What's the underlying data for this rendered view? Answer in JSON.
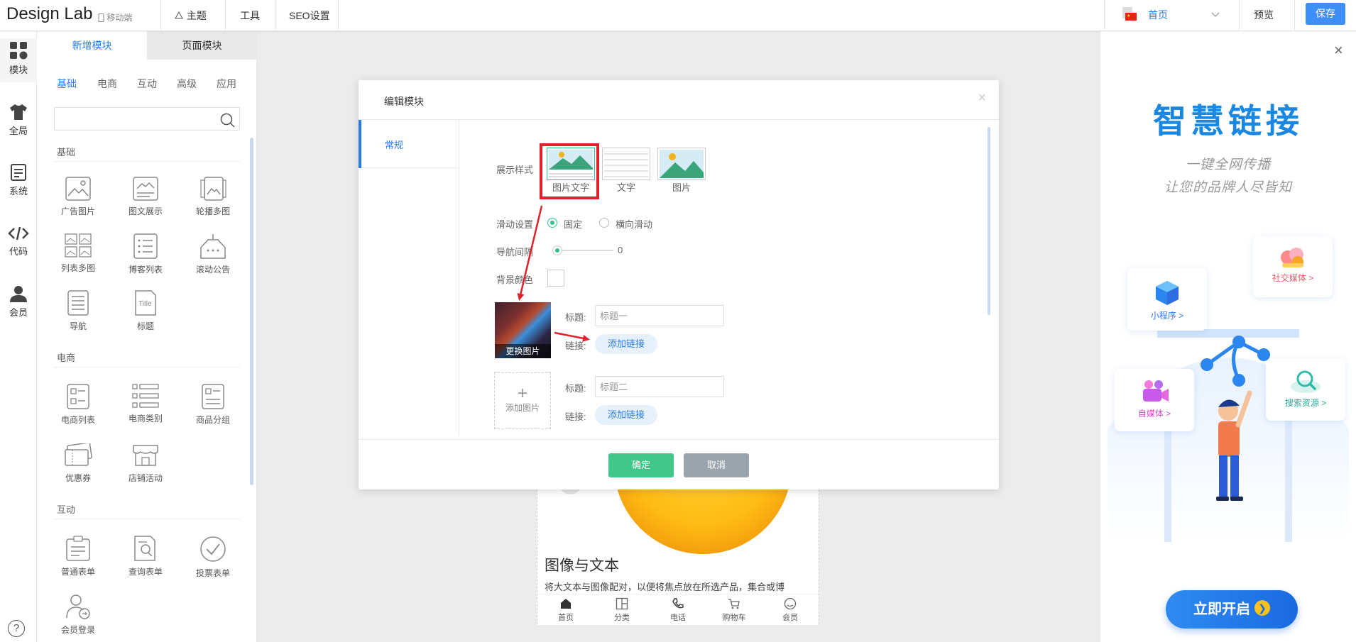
{
  "app": {
    "brand": "Design Lab",
    "mobile_label": "移动端"
  },
  "toolbar": {
    "theme": "主题",
    "tools": "工具",
    "seo": "SEO设置",
    "page_select": "首页",
    "preview": "预览",
    "save": "保存"
  },
  "rail": {
    "modules": "模块",
    "global": "全局",
    "system": "系统",
    "code": "代码",
    "member": "会员",
    "help": "?"
  },
  "panel": {
    "tab_new": "新增模块",
    "tab_page": "页面模块",
    "categories": [
      "基础",
      "电商",
      "互动",
      "高级",
      "应用"
    ],
    "sections": {
      "basic": "基础",
      "ecommerce": "电商",
      "interactive": "互动"
    },
    "basic_items": [
      "广告图片",
      "图文展示",
      "轮播多图",
      "列表多图",
      "博客列表",
      "滚动公告",
      "导航",
      "标题"
    ],
    "ecommerce_items": [
      "电商列表",
      "电商类别",
      "商品分组",
      "优惠券",
      "店铺活动"
    ],
    "interactive_items": [
      "普通表单",
      "查询表单",
      "投票表单",
      "会员登录"
    ]
  },
  "phone": {
    "title": "图像与文本",
    "desc": "将大文本与图像配对，以便将焦点放在所选产品，集合或博",
    "nav": [
      "首页",
      "分类",
      "电话",
      "购物车",
      "会员"
    ]
  },
  "dialog": {
    "title": "编辑模块",
    "close": "×",
    "side_tab": "常规",
    "display_style_label": "展示样式",
    "styles": [
      "图片文字",
      "文字",
      "图片"
    ],
    "scroll_label": "滑动设置",
    "scroll_fixed": "固定",
    "scroll_horizontal": "横向滑动",
    "nav_gap_label": "导航间隔",
    "nav_gap_value": "0",
    "bg_color_label": "背景颜色",
    "item1": {
      "change_image": "更换图片",
      "title_label": "标题:",
      "title_placeholder": "标题一",
      "link_label": "链接:",
      "link_button": "添加链接"
    },
    "item2": {
      "add_image": "添加图片",
      "title_label": "标题:",
      "title_placeholder": "标题二",
      "link_label": "链接:",
      "link_button": "添加链接"
    },
    "ok": "确定",
    "cancel": "取消"
  },
  "ad": {
    "headline": "智慧链接",
    "sub1": "一键全网传播",
    "sub2": "让您的品牌人尽皆知",
    "cards": {
      "social": "社交媒体 >",
      "mini": "小程序 >",
      "media": "自媒体 >",
      "search": "搜索资源 >"
    },
    "cta": "立即开启",
    "close": "×"
  },
  "colors": {
    "accent": "#2b7be4",
    "save_button": "#3e8ef7",
    "ok_button": "#41c789",
    "cancel_button": "#9aa4ad",
    "highlight": "#e0202a"
  }
}
